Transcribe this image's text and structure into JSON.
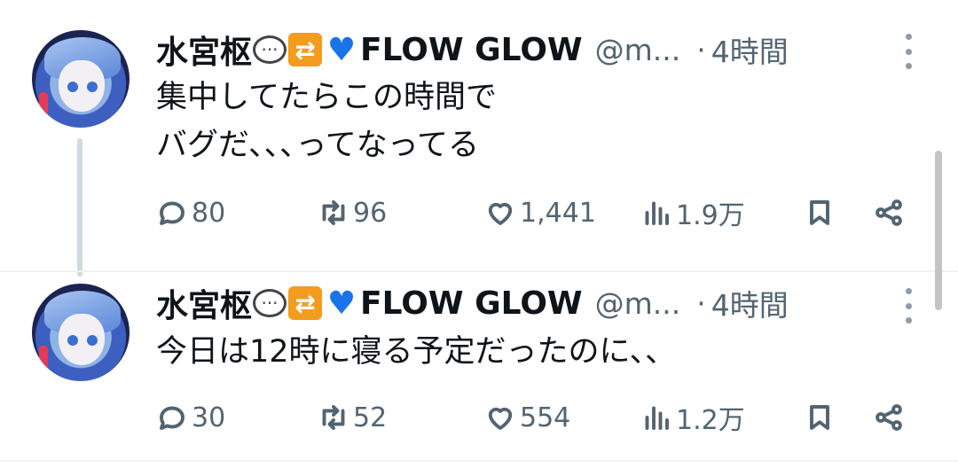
{
  "tweets": [
    {
      "display_name": "水宮枢",
      "name_suffix": "FLOW GLOW",
      "handle": "@m...",
      "separator": "·",
      "time": "4時間",
      "text": "集中してたらこの時間で\nバグだ､､､ってなってる",
      "replies": "80",
      "retweets": "96",
      "likes": "1,441",
      "views": "1.9万"
    },
    {
      "display_name": "水宮枢",
      "name_suffix": "FLOW GLOW",
      "handle": "@m...",
      "separator": "·",
      "time": "4時間",
      "text": "今日は12時に寝る予定だったのに､､",
      "replies": "30",
      "retweets": "52",
      "likes": "554",
      "views": "1.2万"
    }
  ],
  "icons": {
    "name_emojis": [
      "speech-bubble-emoji",
      "repeat-emoji",
      "blue-heart-emoji"
    ],
    "actions": [
      "reply-icon",
      "retweet-icon",
      "like-icon",
      "views-icon",
      "bookmark-icon",
      "share-icon"
    ],
    "more": "more-vertical-icon"
  },
  "colors": {
    "text": "#0f1419",
    "secondary": "#536471",
    "thread_line": "#cfd9de",
    "heart_emoji": "#1a73e8",
    "repeat_emoji": "#f39c1f"
  }
}
